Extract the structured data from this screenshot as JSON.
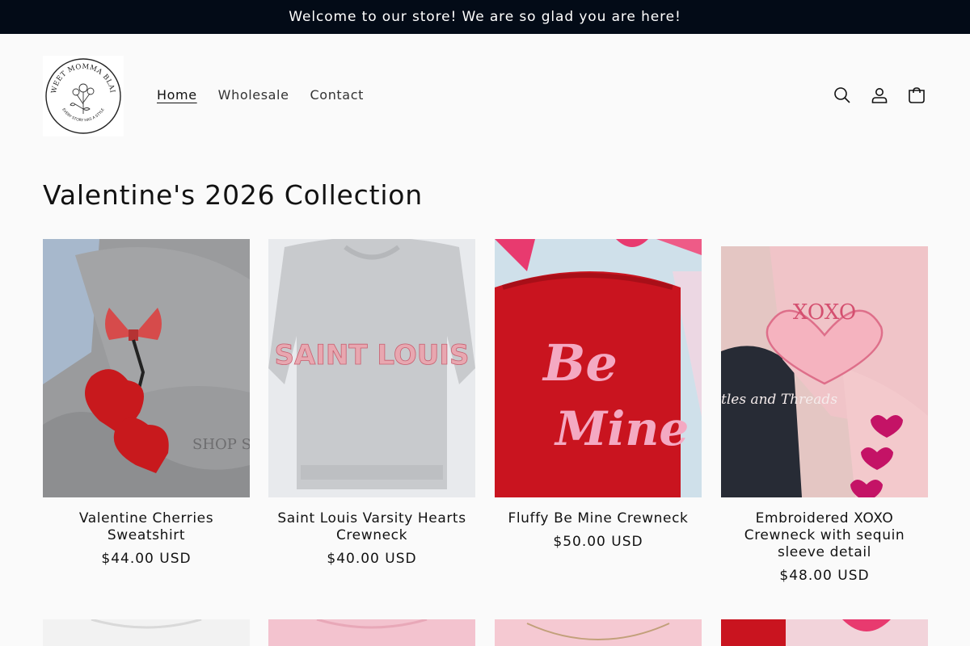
{
  "announcement": {
    "text": "Welcome to our store! We are so glad you are here!"
  },
  "logo": {
    "brand": "SWEET MOMMA BLAIR",
    "tagline": "EVERY STORY HAS A STYLE"
  },
  "nav": {
    "items": [
      {
        "label": "Home",
        "active": true
      },
      {
        "label": "Wholesale",
        "active": false
      },
      {
        "label": "Contact",
        "active": false
      }
    ]
  },
  "header_icons": [
    "search-icon",
    "account-icon",
    "cart-icon"
  ],
  "collection": {
    "title": "Valentine's 2026 Collection",
    "products": [
      {
        "name": "Valentine Cherries Sweatshirt",
        "price": "$44.00 USD",
        "image_watermark": "SHOP Southern"
      },
      {
        "name": "Saint Louis Varsity Hearts Crewneck",
        "price": "$40.00 USD",
        "image_text": "SAINT LOUIS"
      },
      {
        "name": "Fluffy Be Mine Crewneck",
        "price": "$50.00 USD",
        "image_text_1": "Be",
        "image_text_2": "Mine"
      },
      {
        "name": "Embroidered XOXO Crewneck with sequin sleeve detail",
        "price": "$48.00 USD",
        "image_text_1": "XOXO",
        "image_text_2": "tles and Threads"
      }
    ]
  },
  "colors": {
    "announcement_bg": "#030b17",
    "page_bg": "#fafafa",
    "text": "#121212"
  }
}
